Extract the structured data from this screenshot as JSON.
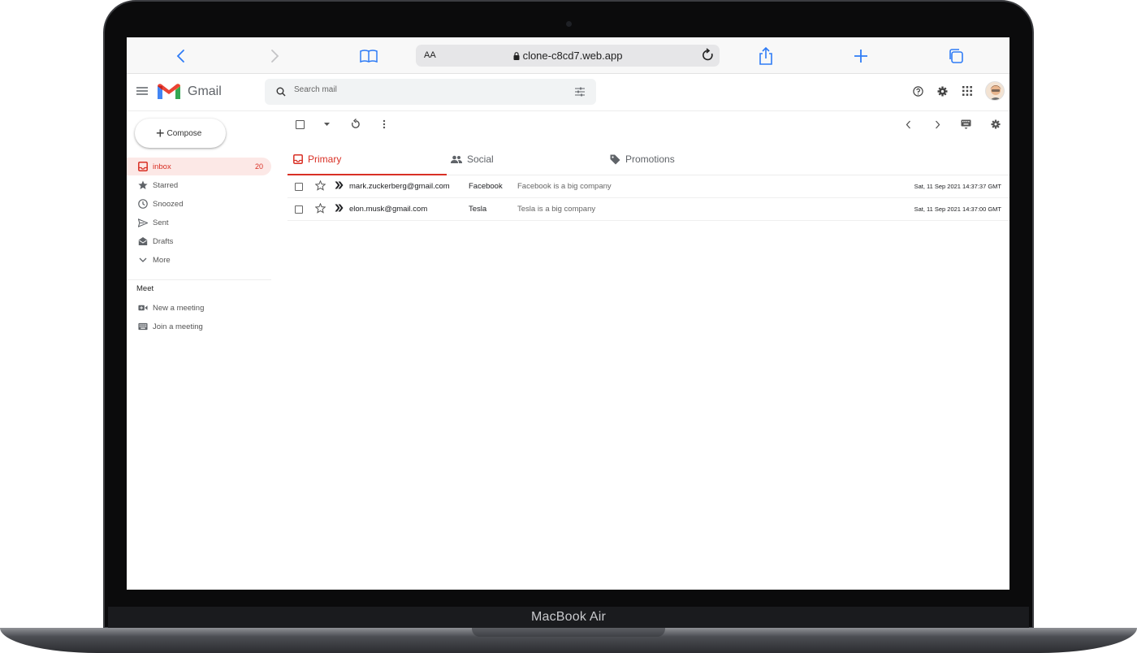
{
  "device": {
    "label": "MacBook Air"
  },
  "browser": {
    "url": "clone-c8cd7.web.app",
    "text_size_label": "AA"
  },
  "gmail": {
    "brand": "Gmail",
    "search": {
      "placeholder": "Search mail"
    },
    "compose_label": "Compose",
    "sidebar": [
      {
        "label": "inbox",
        "icon": "inbox-icon",
        "count": "20",
        "active": true
      },
      {
        "label": "Starred",
        "icon": "star-icon"
      },
      {
        "label": "Snoozed",
        "icon": "clock-icon"
      },
      {
        "label": "Sent",
        "icon": "send-icon"
      },
      {
        "label": "Drafts",
        "icon": "drafts-icon"
      },
      {
        "label": "More",
        "icon": "chevron-down-icon"
      }
    ],
    "meet": {
      "title": "Meet",
      "items": [
        {
          "label": "New a meeting",
          "icon": "videocam-icon"
        },
        {
          "label": "Join a meeting",
          "icon": "keyboard-icon"
        }
      ]
    },
    "tabs": [
      {
        "label": "Primary",
        "icon": "inbox-icon",
        "active": true
      },
      {
        "label": "Social",
        "icon": "people-icon"
      },
      {
        "label": "Promotions",
        "icon": "tag-icon"
      }
    ],
    "emails": [
      {
        "sender": "mark.zuckerberg@gmail.com",
        "subject": "Facebook",
        "description": "Facebook is a big company",
        "time": "Sat, 11 Sep 2021 14:37:37 GMT"
      },
      {
        "sender": "elon.musk@gmail.com",
        "subject": "Tesla",
        "description": "Tesla is a big company",
        "time": "Sat, 11 Sep 2021 14:37:00 GMT"
      }
    ]
  },
  "colors": {
    "accent": "#d93025",
    "active_bg": "#fce8e6",
    "search_bg": "#f1f3f4",
    "safari_blue": "#2f7cf6"
  }
}
